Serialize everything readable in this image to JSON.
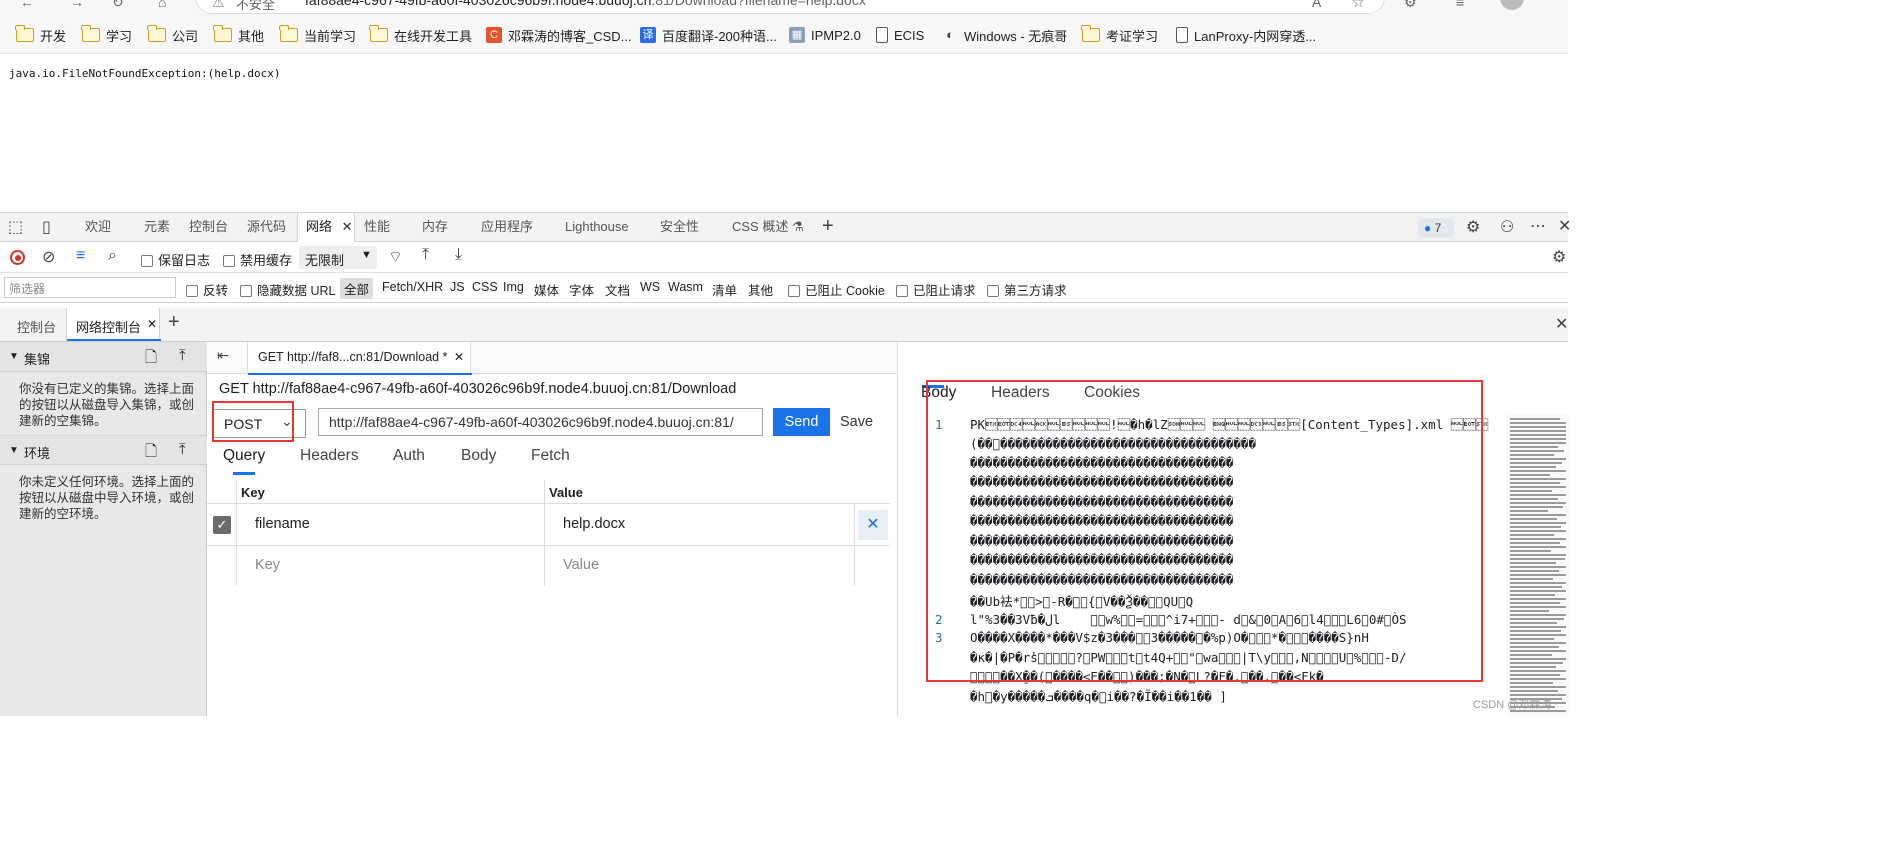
{
  "browser": {
    "url_host": "faf88ae4-c967-49fb-a60f-403026c96b9f.node4.buuoj.cn",
    "url_path": ":81/Download?filename=help.docx",
    "security_label": "不安全",
    "bookmarks": [
      {
        "icon": "folder-icon",
        "label": "开发"
      },
      {
        "icon": "folder-icon",
        "label": "学习"
      },
      {
        "icon": "folder-icon",
        "label": "公司"
      },
      {
        "icon": "folder-icon",
        "label": "其他"
      },
      {
        "icon": "folder-icon",
        "label": "当前学习"
      },
      {
        "icon": "folder-icon",
        "label": "在线开发工具"
      },
      {
        "icon": "csdn-icon",
        "label": "邓霖涛的博客_CSD..."
      },
      {
        "icon": "translate-icon",
        "label": "百度翻译-200种语..."
      },
      {
        "icon": "ipmp-icon",
        "label": "IPMP2.0"
      },
      {
        "icon": "document-icon",
        "label": "ECIS"
      },
      {
        "icon": "incognito-icon",
        "label": "Windows - 无痕哥"
      },
      {
        "icon": "folder-icon",
        "label": "考证学习"
      },
      {
        "icon": "document-icon",
        "label": "LanProxy-内网穿透..."
      }
    ]
  },
  "page": {
    "exception_text": "java.io.FileNotFoundException:(help.docx)"
  },
  "devtools": {
    "tabs": [
      "欢迎",
      "元素",
      "控制台",
      "源代码",
      "网络",
      "性能",
      "内存",
      "应用程序",
      "Lighthouse",
      "安全性",
      "CSS 概述"
    ],
    "active_tab": "网络",
    "issues_count": "7",
    "toolbar": {
      "preserve_log": "保留日志",
      "disable_cache": "禁用缓存",
      "throttle": "无限制"
    },
    "filter": {
      "placeholder": "筛选器",
      "invert": "反转",
      "hide_data_url": "隐藏数据 URL",
      "types": [
        "全部",
        "Fetch/XHR",
        "JS",
        "CSS",
        "Img",
        "媒体",
        "字体",
        "文档",
        "WS",
        "Wasm",
        "清单",
        "其他"
      ],
      "active_type": "全部",
      "blocked_cookies": "已阻止 Cookie",
      "blocked_requests": "已阻止请求",
      "third_party": "第三方请求"
    },
    "drawer_tabs": [
      "控制台",
      "网络控制台"
    ],
    "sidebar": {
      "collections_title": "集锦",
      "collections_desc": "你没有已定义的集锦。选择上面的按钮以从磁盘导入集锦，或创建新的空集锦。",
      "env_title": "环境",
      "env_desc": "你未定义任何环境。选择上面的按钮以从磁盘中导入环境，或创建新的空环境。"
    },
    "request": {
      "tab_label": "GET http://faf8...cn:81/Download *",
      "title": "GET http://faf88ae4-c967-49fb-a60f-403026c96b9f.node4.buuoj.cn:81/Download",
      "method": "POST",
      "url": "http://faf88ae4-c967-49fb-a60f-403026c96b9f.node4.buuoj.cn:81/",
      "send": "Send",
      "save": "Save",
      "tabs": [
        "Query",
        "Headers",
        "Auth",
        "Body",
        "Fetch"
      ],
      "active_tab": "Query",
      "col_key": "Key",
      "col_value": "Value",
      "params": [
        {
          "key": "filename",
          "value": "help.docx",
          "checked": true
        }
      ],
      "new_key_placeholder": "Key",
      "new_value_placeholder": "Value"
    },
    "response": {
      "tabs": [
        "Body",
        "Headers",
        "Cookies"
      ],
      "active_tab": "Body",
      "line1_a": "PK\u0003\u0004\u0014\u0000\u0006\u0000\b\u0000\u0000\u0000!\u0000�h�lZ\u0001\u0000\u0000 \u0005\u0000\u0000\u0013\u0000\b\u0002[Content_Types].xml \u0000\u0004\u0002",
      "line1_b": "(��\u0000����������������������������������",
      "fill_row": "�����������������������������������",
      "line1_z": "��Ub袪*\u0000\u0000>\u0000-R�\u0000\u0000{\u0000V��Ѯ��\u0000\u0000QU\u0000Q",
      "line2": "l\"%3��3Vƀ�لl    \u0000\u0000w%\u0000\u0000=\u0000\u0000\u0000^i7+\u0000\u0000\u0000- d\u0000&\u00000\u0000A\u00006\u0000l4\u0000\u0000\u0000L6\u00000#\u0000ÒS",
      "line3_a": "O����X����*���V$z�3���\u0000\u00003�����\u0000�%p)O�\u0000\u0000\u0000*�\u0000\u0000\u0000����S}nH",
      "line3_b": "�ĸ�|�P�rٔs\u0000\u0000\u0000\u0000\u0000?\u0000PW\u0000\u0000\u0000t\u0000t4Q+\u0000\u0000\"\u0000wa\u0000\u0000\u0000|T\\y\u0000\u0000\u0000,N\u0000\u0000\u0000\u0000U\u0000%\u0000\u0000\u0000-D/",
      "line3_c": "\u0000\u0000\u0000ٰ��X�ٍ�(\u0000����<E��\u0000\u0000)���;�N�\u0000L?�F�.\u0000��.\u0000��<Fk�",
      "line3_d": "�h\u0000�y�����ܒ����q�\u0000i��?�Ĩ��i��1�� ]"
    },
    "watermark": "CSDN @邓霖涛"
  }
}
